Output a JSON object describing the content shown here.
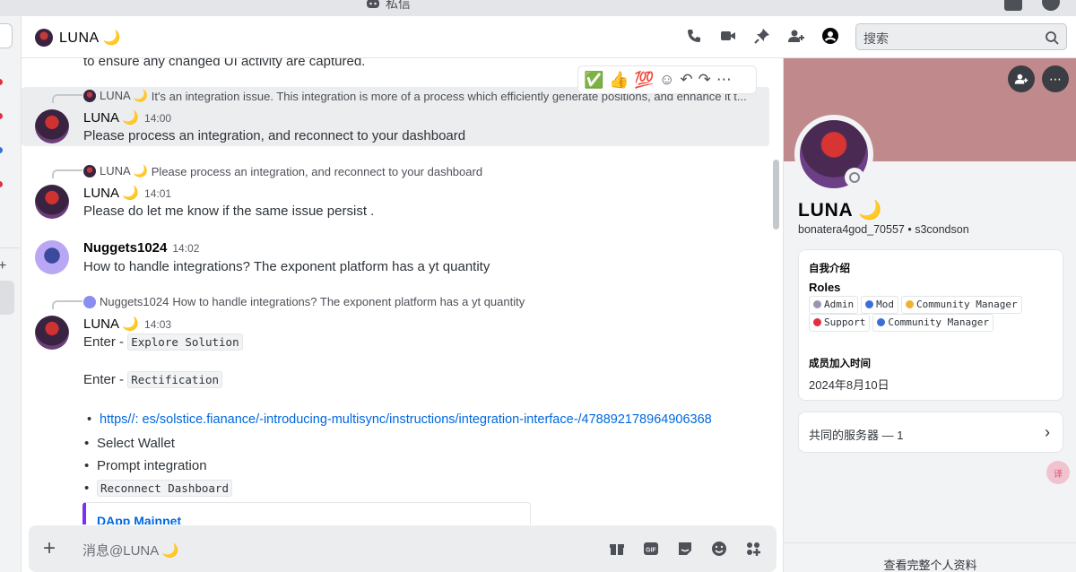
{
  "window": {
    "title": "私信"
  },
  "header": {
    "name": "LUNA 🌙",
    "search_placeholder": "搜索",
    "icons": [
      "phone-call-icon",
      "video-camera-icon",
      "pin-icon",
      "add-friend-icon",
      "user-profile-icon"
    ]
  },
  "toolbar_reactions": [
    "✅",
    "👍",
    "💯"
  ],
  "messages": {
    "top_partial": "to ensure any changed UI activity are captured.",
    "m1": {
      "reply_name": "LUNA 🌙",
      "reply_text": "It's an integration issue. This integration is more of a process which efficiently generate positions, and enhance it t...",
      "author": "LUNA 🌙",
      "time": "14:00",
      "text": "Please process an integration, and reconnect to your dashboard"
    },
    "m2": {
      "reply_name": "LUNA 🌙",
      "reply_text": "Please process an integration, and reconnect to your dashboard",
      "author": "LUNA 🌙",
      "time": "14:01",
      "text": "Please do let me know if the same issue persist ."
    },
    "m3": {
      "author": "Nuggets1024",
      "time": "14:02",
      "text": "How to handle integrations?   The exponent platform has a yt quantity"
    },
    "m4": {
      "reply_name": "Nuggets1024",
      "reply_text": "How to handle integrations?   The exponent platform has a yt quantity",
      "author": "LUNA 🌙",
      "time": "14:03",
      "enter_label": "Enter - ",
      "code1": "Explore Solution",
      "code2": "Rectification",
      "link": "https//: es/solstice.fianance/-introducing-multisync/instructions/integration-interface-/478892178964906368",
      "bullet2": "Select Wallet",
      "bullet3": "Prompt integration",
      "bullet4_code": "Reconnect Dashboard",
      "embed_title": "DApp Mainnet"
    }
  },
  "composer": {
    "placeholder": "消息@LUNA 🌙"
  },
  "profile": {
    "name": "LUNA 🌙",
    "handle": "bonatera4god_70557 • s3condson",
    "about_heading": "自我介绍",
    "roles_heading": "Roles",
    "roles": [
      {
        "label": "Admin",
        "color": "#9c94b4"
      },
      {
        "label": "Mod",
        "color": "#3b6fd8"
      },
      {
        "label": "Community Manager",
        "color": "#f0b232"
      },
      {
        "label": "Support",
        "color": "#e0303e"
      },
      {
        "label": "Community Manager",
        "color": "#3b6fd8"
      }
    ],
    "member_since_heading": "成员加入时间",
    "member_since": "2024年8月10日",
    "mutual_servers": "共同的服务器 — 1",
    "view_full": "查看完整个人资料"
  }
}
